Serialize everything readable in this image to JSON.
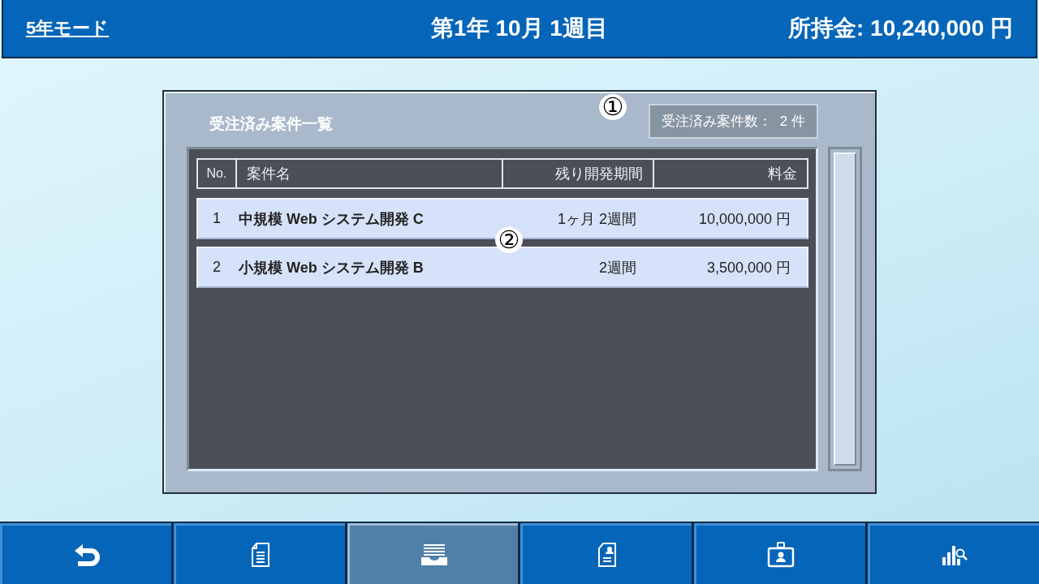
{
  "header": {
    "mode_link": "5年モード",
    "date": "第1年 10月 1週目",
    "money": "所持金: 10,240,000 円"
  },
  "panel": {
    "title": "受注済み案件一覧",
    "count_label": "受注済み案件数：",
    "count_value": "2 件",
    "columns": [
      "No.",
      "案件名",
      "残り開発期間",
      "料金"
    ],
    "rows": [
      {
        "no": "1",
        "name": "中規模 Web システム開発 C",
        "period": "1ヶ月 2週間",
        "fee": "10,000,000 円"
      },
      {
        "no": "2",
        "name": "小規模 Web システム開発 B",
        "period": "2週間",
        "fee": "3,500,000 円"
      }
    ]
  },
  "annotations": [
    "①",
    "②"
  ],
  "nav": [
    {
      "kind": "back",
      "selected": false
    },
    {
      "kind": "document",
      "selected": false
    },
    {
      "kind": "inbox",
      "selected": true
    },
    {
      "kind": "person-document",
      "selected": false
    },
    {
      "kind": "badge",
      "selected": false
    },
    {
      "kind": "chart",
      "selected": false
    }
  ]
}
